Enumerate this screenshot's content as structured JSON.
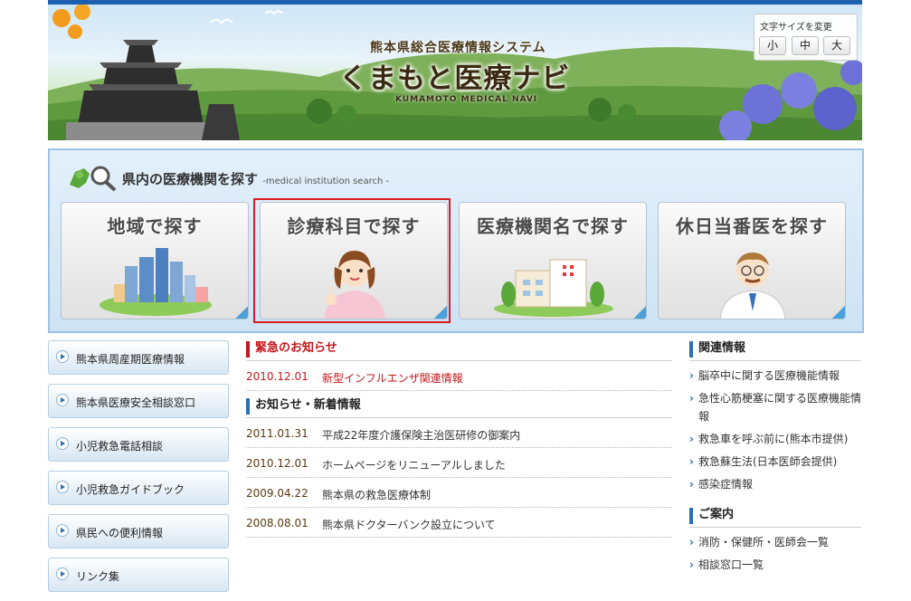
{
  "header": {
    "subtitle": "熊本県総合医療情報システム",
    "title": "くまもと医療ナビ",
    "romaji": "KUMAMOTO MEDICAL NAVI"
  },
  "font_size": {
    "label": "文字サイズを変更",
    "small": "小",
    "medium": "中",
    "large": "大"
  },
  "search": {
    "heading": "県内の医療機関を探す",
    "heading_en": "-medical institution search -",
    "buttons": [
      {
        "label": "地域で探す"
      },
      {
        "label": "診療科目で探す"
      },
      {
        "label": "医療機関名で探す"
      },
      {
        "label": "休日当番医を探す"
      }
    ]
  },
  "sidenav": [
    {
      "label": "熊本県周産期医療情報"
    },
    {
      "label": "熊本県医療安全相談窓口"
    },
    {
      "label": "小児救急電話相談"
    },
    {
      "label": "小児救急ガイドブック"
    },
    {
      "label": "県民への便利情報"
    },
    {
      "label": "リンク集"
    }
  ],
  "urgent": {
    "heading": "緊急のお知らせ",
    "items": [
      {
        "date": "2010.12.01",
        "text": "新型インフルエンザ関連情報"
      }
    ]
  },
  "news": {
    "heading": "お知らせ・新着情報",
    "items": [
      {
        "date": "2011.01.31",
        "text": "平成22年度介護保険主治医研修の御案内"
      },
      {
        "date": "2010.12.01",
        "text": "ホームページをリニューアルしました"
      },
      {
        "date": "2009.04.22",
        "text": "熊本県の救急医療体制"
      },
      {
        "date": "2008.08.01",
        "text": "熊本県ドクターバンク設立について"
      }
    ]
  },
  "related": {
    "heading": "関連情報",
    "items": [
      {
        "text": "脳卒中に関する医療機能情報"
      },
      {
        "text": "急性心筋梗塞に関する医療機能情報"
      },
      {
        "text": "救急車を呼ぶ前に(熊本市提供)"
      },
      {
        "text": "救急蘇生法(日本医師会提供)"
      },
      {
        "text": "感染症情報"
      }
    ]
  },
  "guide": {
    "heading": "ご案内",
    "items": [
      {
        "text": "消防・保健所・医師会一覧"
      },
      {
        "text": "相談窓口一覧"
      }
    ]
  },
  "colors": {
    "accent_blue": "#2b6fb5",
    "urgent_red": "#c4161c",
    "selected_frame": "#d81c24"
  }
}
